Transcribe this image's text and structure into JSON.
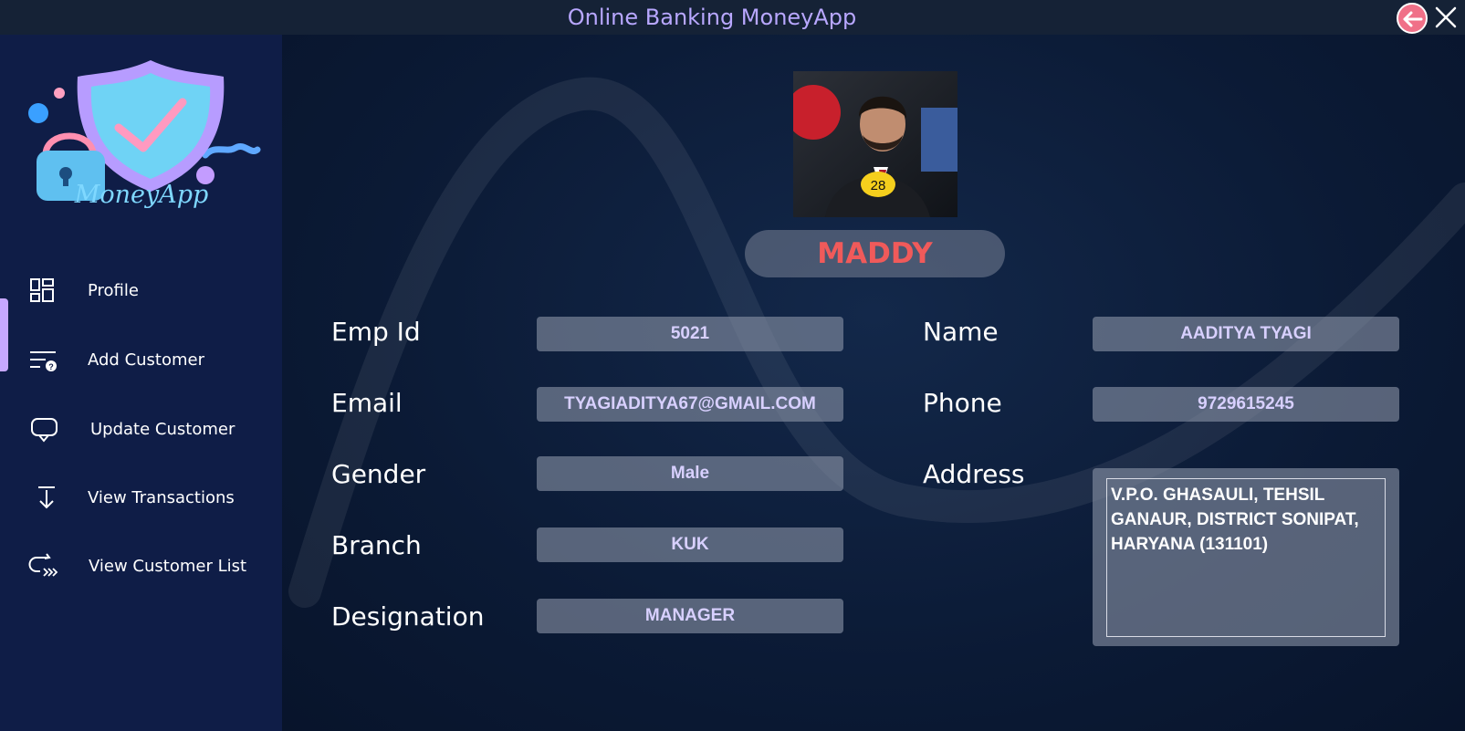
{
  "window": {
    "title": "Online Banking MoneyApp"
  },
  "sidebar": {
    "logo_text": "MoneyApp",
    "active_item": "Profile",
    "items": [
      {
        "label": "Profile",
        "icon": "dashboard-grid-icon"
      },
      {
        "label": "Add Customer",
        "icon": "add-customer-list-icon"
      },
      {
        "label": "Update Customer",
        "icon": "update-chat-icon"
      },
      {
        "label": "View Transactions",
        "icon": "arrow-down-bar-icon"
      },
      {
        "label": "View Customer List",
        "icon": "list-forward-icon"
      }
    ]
  },
  "profile": {
    "display_name": "MADDY",
    "photo_badge": "28",
    "fields": {
      "emp_id": {
        "label": "Emp Id",
        "value": "5021"
      },
      "email": {
        "label": "Email",
        "value": "TYAGIADITYA67@GMAIL.COM"
      },
      "gender": {
        "label": "Gender",
        "value": "Male"
      },
      "branch": {
        "label": "Branch",
        "value": "KUK"
      },
      "designation": {
        "label": "Designation",
        "value": "MANAGER"
      },
      "name": {
        "label": "Name",
        "value": "AADITYA TYAGI"
      },
      "phone": {
        "label": "Phone",
        "value": "9729615245"
      },
      "address": {
        "label": "Address",
        "value": "V.P.O. GHASAULI, TEHSIL GANAUR, DISTRICT SONIPAT, HARYANA (131101)"
      }
    }
  },
  "colors": {
    "title_text": "#b8a7ff",
    "name_accent": "#f05a5a",
    "field_text": "#d8d0ff",
    "sidebar_bg": "#0f1d47",
    "active_indicator": "#c7a8ff"
  }
}
